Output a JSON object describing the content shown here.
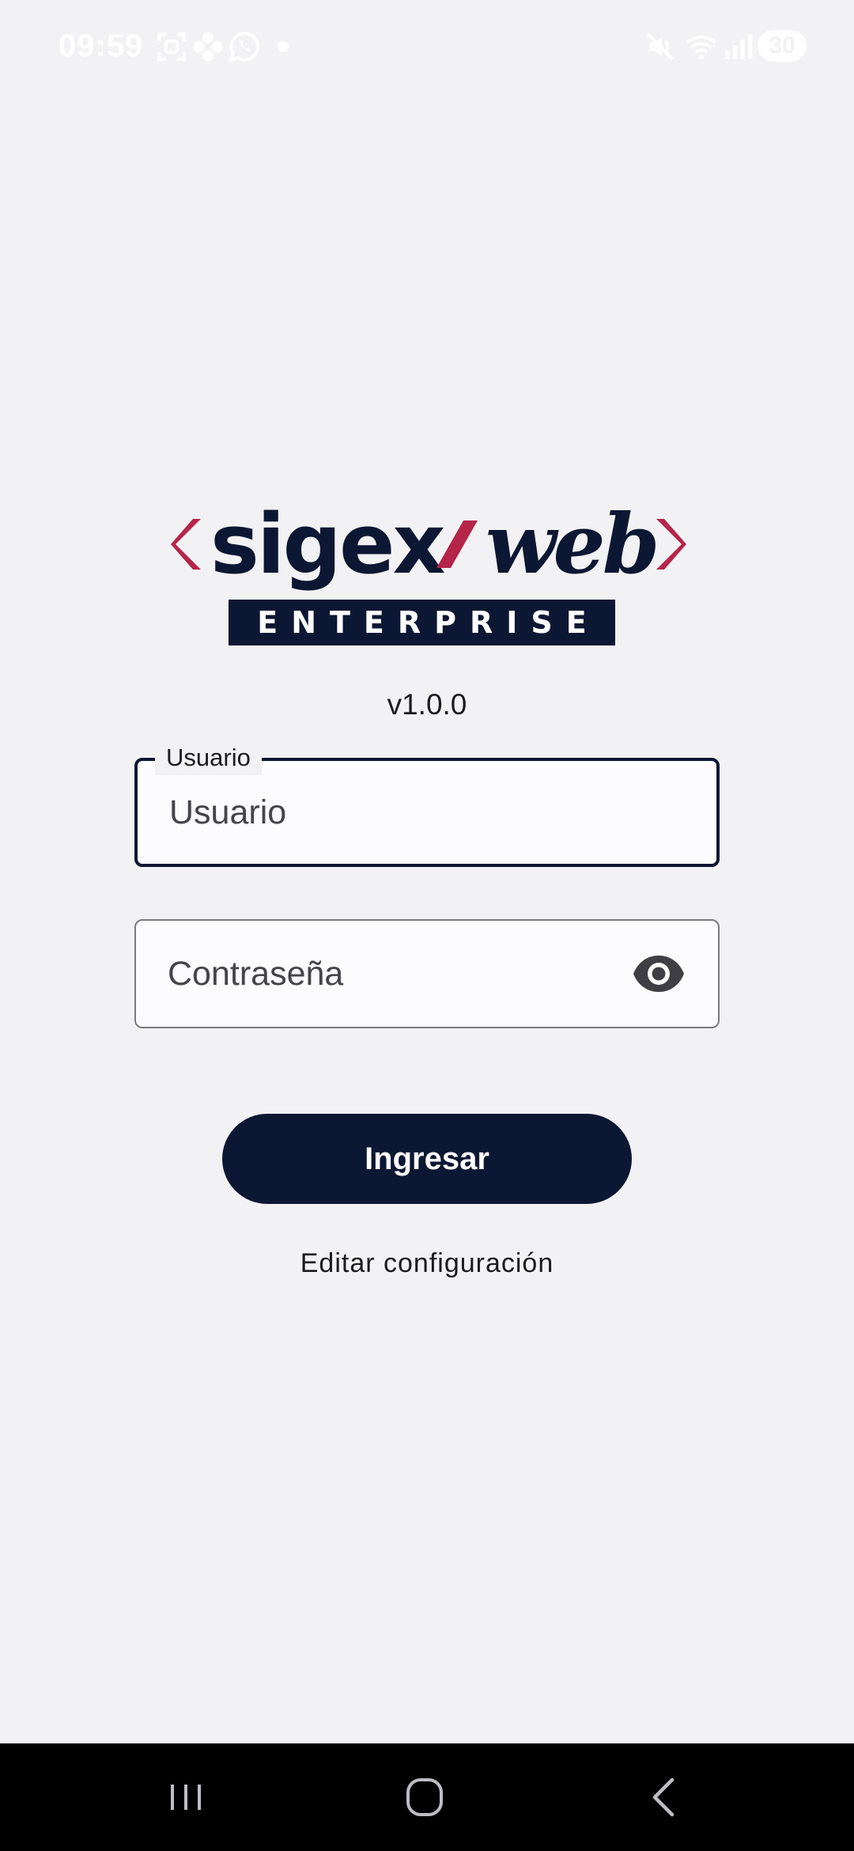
{
  "status_bar": {
    "time": "09:59",
    "battery": "30",
    "icons": [
      "screenshot-icon",
      "flower-icon",
      "whatsapp-icon",
      "dot-icon",
      "mute-icon",
      "wifi-icon",
      "signal-icon"
    ]
  },
  "logo": {
    "left_word": "sigex",
    "right_word": "web",
    "band": "ENTERPRISE",
    "colors": {
      "navy": "#0c1733",
      "crimson": "#b5254a"
    }
  },
  "version": "v1.0.0",
  "username": {
    "label": "Usuario",
    "placeholder": "Usuario",
    "value": ""
  },
  "password": {
    "placeholder": "Contraseña",
    "value": ""
  },
  "login_button": "Ingresar",
  "edit_config_link": "Editar configuración",
  "colors": {
    "background": "#f2f2f4",
    "primary": "#0c1733",
    "text": "#1c1c1f"
  }
}
